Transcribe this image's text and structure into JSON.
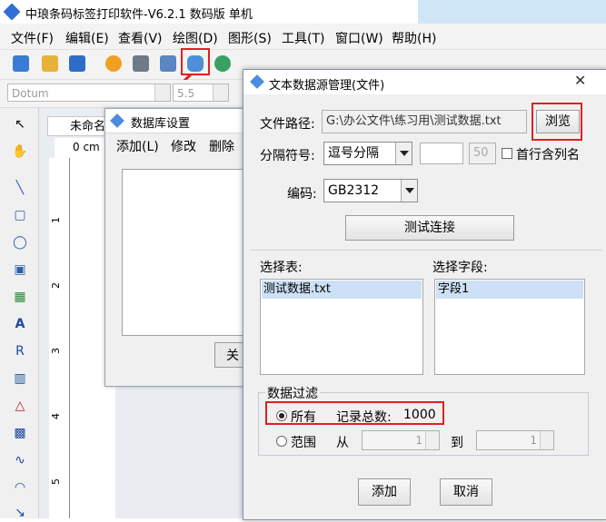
{
  "app": {
    "title": "中琅条码标签打印软件-V6.2.1 数码版 单机"
  },
  "menu": [
    "文件(F)",
    "编辑(E)",
    "查看(V)",
    "绘图(D)",
    "图形(S)",
    "工具(T)",
    "窗口(W)",
    "帮助(H)"
  ],
  "toolbar2": {
    "font_value": "Dotum",
    "size_value": "5.5"
  },
  "document": {
    "tab_label": "未命名",
    "ruler_unit": "0 cm",
    "ruler_marks": [
      "1",
      "2",
      "3",
      "4",
      "5"
    ]
  },
  "ds_dialog": {
    "title": "数据库设置",
    "menu": [
      "添加(L)",
      "修改",
      "删除"
    ],
    "close_label": "关"
  },
  "main_dialog": {
    "title": "文本数据源管理(文件)",
    "path_label": "文件路径:",
    "path_value": "G:\\办公文件\\练习用\\测试数据.txt",
    "browse_label": "浏览",
    "sep_label": "分隔符号:",
    "sep_value": "逗号分隔",
    "sep_extra_value": "50",
    "first_row_label": "首行含列名",
    "encoding_label": "编码:",
    "encoding_value": "GB2312",
    "test_button": "测试连接",
    "table_label": "选择表:",
    "table_item": "测试数据.txt",
    "field_label": "选择字段:",
    "field_item": "字段1",
    "filter_label": "数据过滤",
    "all_label": "所有",
    "record_label": "记录总数:",
    "record_count": "1000",
    "range_label": "范围",
    "from_label": "从",
    "from_value": "1",
    "to_label": "到",
    "to_value": "1",
    "add_button": "添加",
    "cancel_button": "取消"
  },
  "colors": {
    "highlight": "#e02020",
    "selection": "#cde0f5"
  }
}
